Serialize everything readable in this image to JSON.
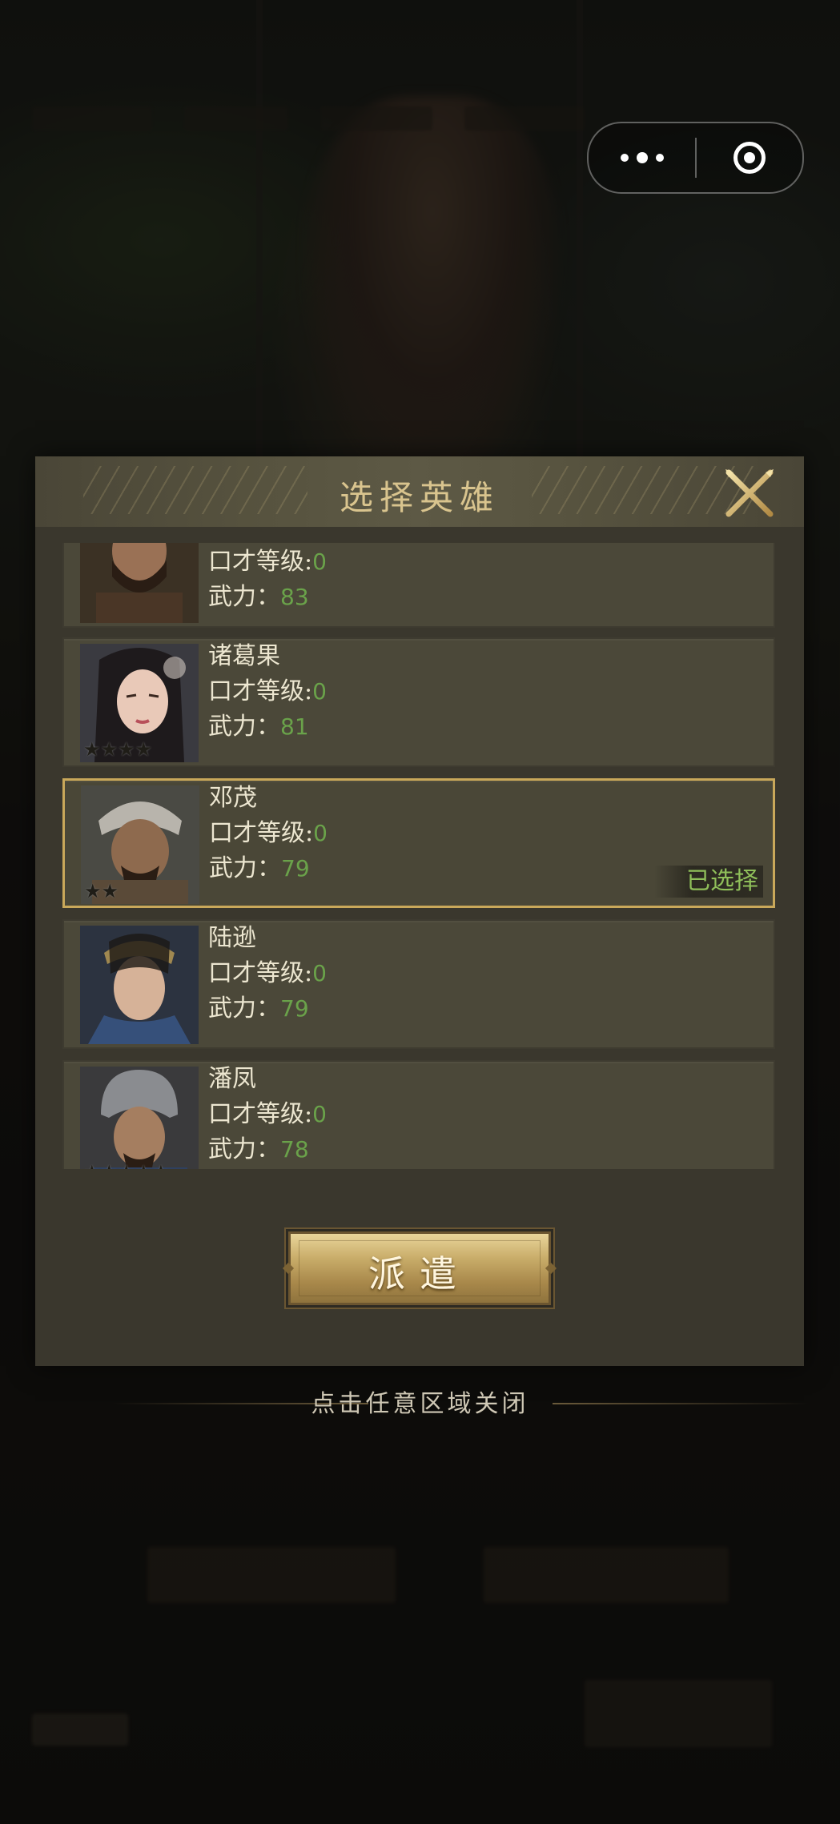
{
  "capsule": {
    "more_icon": "more-dots-icon",
    "close_icon": "target-circle-icon"
  },
  "dialog": {
    "title": "选择英雄",
    "close_icon": "close-x-icon",
    "heroes": [
      {
        "name": "",
        "eloquence_label": "口才等级:",
        "eloquence": "0",
        "force_label": "武力：",
        "force": "83",
        "selected": false
      },
      {
        "name": "诸葛果",
        "eloquence_label": "口才等级:",
        "eloquence": "0",
        "force_label": "武力：",
        "force": "81",
        "selected": false
      },
      {
        "name": "邓茂",
        "eloquence_label": "口才等级:",
        "eloquence": "0",
        "force_label": "武力：",
        "force": "79",
        "selected": true,
        "selected_label": "已选择"
      },
      {
        "name": "陆逊",
        "eloquence_label": "口才等级:",
        "eloquence": "0",
        "force_label": "武力：",
        "force": "79",
        "selected": false
      },
      {
        "name": "潘凤",
        "eloquence_label": "口才等级:",
        "eloquence": "0",
        "force_label": "武力：",
        "force": "78",
        "selected": false
      }
    ],
    "dispatch_label": "派遣"
  },
  "close_hint": "点击任意区域关闭",
  "colors": {
    "accent_gold": "#c9a85a",
    "value_green": "#6aa24a",
    "selected_green": "#8fbf5a"
  }
}
